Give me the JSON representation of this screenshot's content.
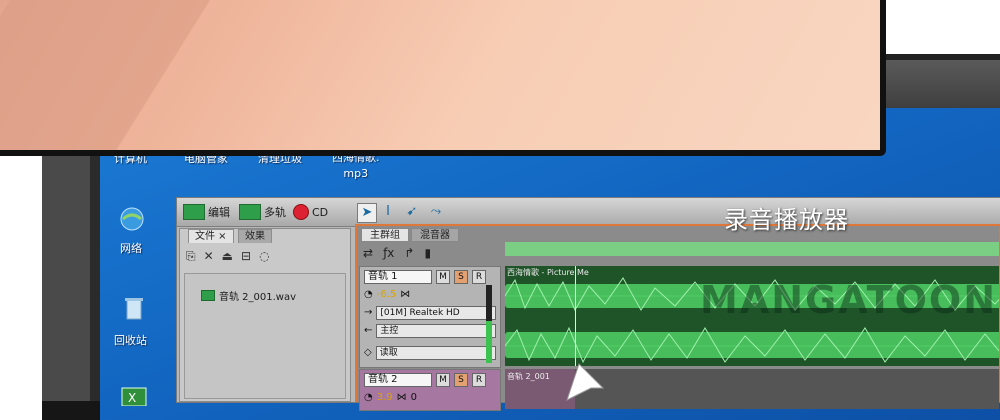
{
  "desktop": {
    "icons": [
      {
        "label": "计算机"
      },
      {
        "label": "电脑管家"
      },
      {
        "label": "清理垃圾"
      },
      {
        "label": "西海情歌.\nmp3"
      },
      {
        "label": "网络"
      },
      {
        "label": "回收站"
      }
    ]
  },
  "overlay_title": "录音播放器",
  "watermark": "MANGATOON",
  "app": {
    "toolbar": {
      "edit_label": "编辑",
      "multitrack_label": "多轨",
      "cd_label": "CD"
    },
    "files_panel": {
      "tab_files": "文件 ×",
      "tab_effects": "效果",
      "file_item": "音轨 2_001.wav"
    },
    "tracks_panel": {
      "tab_main": "主群组",
      "tab_mixer": "混音器",
      "track1": {
        "name": "音轨 1",
        "m": "M",
        "s": "S",
        "r": "R",
        "volume": "-6.5",
        "device": "[01M] Realtek HD",
        "output": "主控",
        "automation": "读取",
        "clip_label": "西海情歌 - Picture Me"
      },
      "track2": {
        "name": "音轨 2",
        "m": "M",
        "s": "S",
        "r": "R",
        "volume": "3.9",
        "pan": "0",
        "clip_label": "音轨 2_001"
      }
    }
  },
  "colors": {
    "wallpaper": "#1266c1",
    "waveform": "#4fd066",
    "track_border": "#e0773a"
  }
}
